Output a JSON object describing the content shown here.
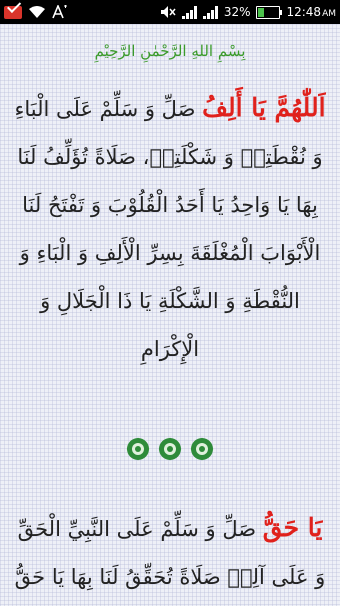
{
  "status_bar": {
    "battery_level": "32%",
    "time": "12:48",
    "time_suffix": "AM",
    "icons": [
      "mail-icon",
      "wifi-icon",
      "font-size-icon",
      "mute-icon",
      "signal-icon",
      "signal-icon-2",
      "battery-icon"
    ]
  },
  "colors": {
    "accent_red": "#e0211c",
    "basmala_green": "#3a9a2a",
    "ornament_green": "#2e8b3a"
  },
  "text": {
    "basmala": "بِسْمِ اللهِ الرَّحْمٰنِ الرَّحِيْمِ",
    "para1_red": "اَللّٰهُمَّ يَا أَلِفُ",
    "para1_body": "صَلِّ وَ سَلِّمْ عَلَى الْبَاءِ وَ نُقْطَتِهٖ وَ شَكْلَتِهٖ، صَلَاةً تُؤَلِّفُ لَنَا بِهَا يَا وَاحِدُ يَا أَحَدُ الْقُلُوْبَ وَ تَفْتَحُ لَنَا الْأَبْوَابَ الْمُغْلَقَةَ بِسِرِّ الْأَلِفِ وَ الْبَاءِ وَ النُّقْطَةِ وَ الشَّكْلَةِ يَا ذَا الْجَلَالِ وَ الْإِكْرَامِ",
    "para2_red": "يَا حَقُّ",
    "para2_body": "صَلِّ وَ سَلِّمْ عَلَى النَّبِيِّ الْحَقِّ وَ عَلَى آلِهٖ صَلَاةً تُحَقِّقُ لَنَا بِهَا يَا حَقُّ"
  }
}
